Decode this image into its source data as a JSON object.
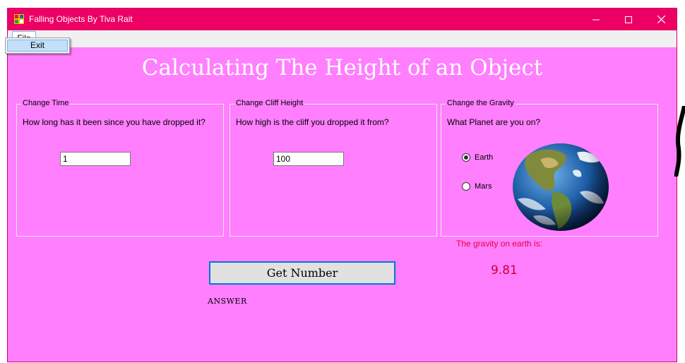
{
  "window": {
    "title": "Falling Objects By Tiva Rait",
    "controls": {
      "minimize": "minimize-icon",
      "maximize": "maximize-icon",
      "close": "close-icon"
    }
  },
  "menu": {
    "file_label": "File",
    "items": [
      {
        "label": "Exit"
      }
    ]
  },
  "heading": "Calculating The Height of an Object",
  "time_group": {
    "legend": "Change Time",
    "question": "How long has it been since you have dropped it?",
    "value": "1"
  },
  "cliff_group": {
    "legend": "Change Cliff Height",
    "question": "How high is the cliff you dropped it from?",
    "value": "100"
  },
  "gravity_group": {
    "legend": "Change the Gravity",
    "question": "What Planet are you on?",
    "options": [
      {
        "label": "Earth",
        "checked": true
      },
      {
        "label": "Mars",
        "checked": false
      }
    ],
    "image": "earth-globe-image"
  },
  "gravity_result": {
    "label": "The gravity on earth is:",
    "value": "9.81"
  },
  "actions": {
    "get_number_label": "Get Number"
  },
  "answer_label": "ANSWER",
  "colors": {
    "titlebar": "#ec0063",
    "form_background": "#ff7fff",
    "gravity_text": "#e6003e",
    "button_border": "#0078d7"
  }
}
